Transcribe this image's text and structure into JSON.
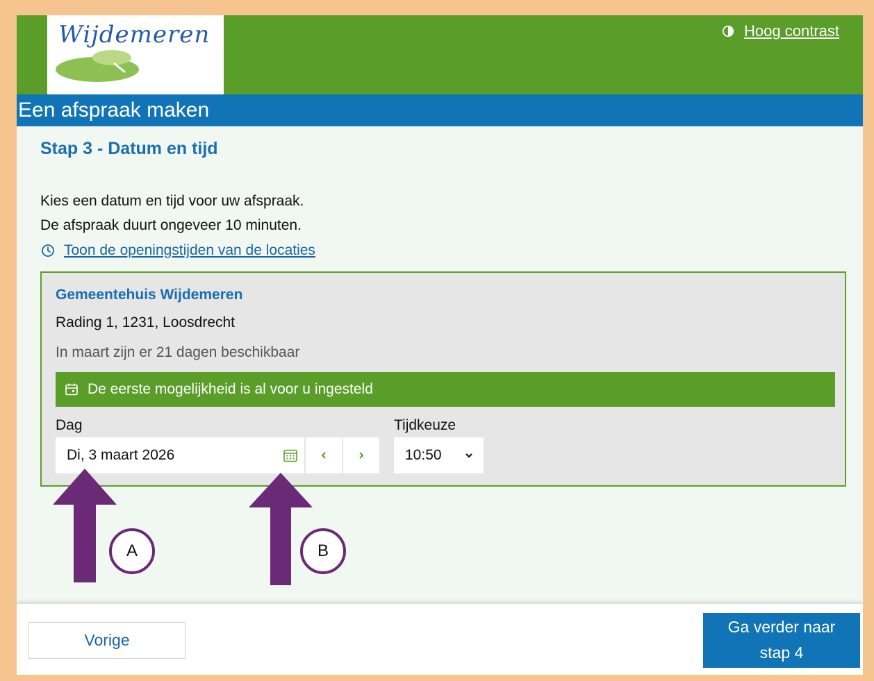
{
  "header": {
    "logo_text": "Wijdemeren",
    "contrast_link": "Hoog contrast"
  },
  "page_title": "Een afspraak maken",
  "step_title": "Stap 3 - Datum en tijd",
  "intro": {
    "line1": "Kies een datum en tijd voor uw afspraak.",
    "line2": "De afspraak duurt ongeveer 10 minuten."
  },
  "hours_link": "Toon de openingstijden van de locaties",
  "location": {
    "name": "Gemeentehuis Wijdemeren",
    "address": "Rading 1, 1231, Loosdrecht",
    "availability": "In maart zijn er 21 dagen beschikbaar",
    "notice": "De eerste mogelijkheid is al voor u ingesteld"
  },
  "date_field": {
    "label": "Dag",
    "value": "Di, 3 maart 2026"
  },
  "time_field": {
    "label": "Tijdkeuze",
    "value": "10:50"
  },
  "annotations": {
    "a": "A",
    "b": "B"
  },
  "footer": {
    "prev_label": "Vorige",
    "next_line1": "Ga verder naar",
    "next_line2": "stap 4"
  },
  "colors": {
    "header_green": "#5a9e29",
    "title_blue": "#1074b6",
    "link_blue": "#1a64a8",
    "annotation_purple": "#6a2a76",
    "page_border": "#f5c48f"
  },
  "icons": {
    "contrast": "half-circle-contrast-icon",
    "hours": "clock-icon",
    "notice": "calendar-check-icon",
    "date_picker": "calendar-icon",
    "previous_day": "chevron-left-icon",
    "next_day": "chevron-right-icon",
    "select": "chevron-down-icon"
  }
}
